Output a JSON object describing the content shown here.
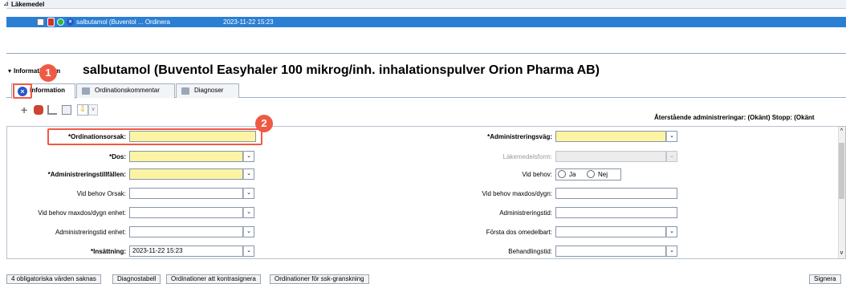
{
  "lakemedel": {
    "section_title": "Läkemedel",
    "row_text": "salbutamol (Buventol ... Ordinera",
    "row_date": "2023-11-22 15:23"
  },
  "info": {
    "prefix": "Information om",
    "title": "salbutamol (Buventol Easyhaler 100 mikrog/inh. inhalationspulver Orion Pharma AB)"
  },
  "tabs": [
    {
      "label": "Information"
    },
    {
      "label": "Ordinationskommentar"
    },
    {
      "label": "Diagnoser"
    }
  ],
  "annotations": {
    "one": "1",
    "two": "2"
  },
  "toolbar": {
    "status": "Återstående administreringar: (Okänt)  Stopp: (Okänt"
  },
  "form": {
    "left": [
      {
        "label": "*Ordinationsorsak:",
        "value": ""
      },
      {
        "label": "*Dos:",
        "value": ""
      },
      {
        "label": "*Administreringstillfällen:",
        "value": ""
      },
      {
        "label": "Vid behov Orsak:",
        "value": ""
      },
      {
        "label": "Vid behov maxdos/dygn enhet:",
        "value": ""
      },
      {
        "label": "Administreringstid enhet:",
        "value": ""
      },
      {
        "label": "*Insättning:",
        "value": "2023-11-22 15:23"
      }
    ],
    "right": [
      {
        "label": "*Administreringsväg:",
        "value": ""
      },
      {
        "label": "Läkemedelsform:",
        "value": ""
      },
      {
        "label": "Vid behov:",
        "value": ""
      },
      {
        "label": "Vid behov maxdos/dygn:",
        "value": ""
      },
      {
        "label": "Administreringstid:",
        "value": ""
      },
      {
        "label": "Första dos omedelbart:",
        "value": ""
      },
      {
        "label": "Behandlingstid:",
        "value": ""
      }
    ],
    "radio_yes": "Ja",
    "radio_no": "Nej"
  },
  "bottom": {
    "buttons": [
      "4 obligatoriska värden saknas",
      "Diagnostabell",
      "Ordinationer att kontrasignera",
      "Ordinationer för ssk-granskning"
    ],
    "sign": "Signera"
  },
  "colors": {
    "required_field": "#fdf4a3",
    "selection": "#2a7fd4",
    "annotation": "#ef5a45"
  }
}
